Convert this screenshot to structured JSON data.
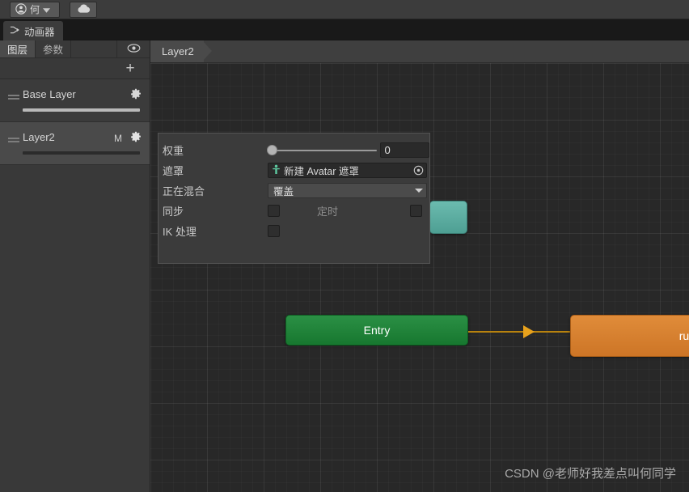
{
  "titlebar": {
    "account_icon": "account-avatar-icon",
    "account_name": "何",
    "dropdown_icon": "chevron-down-icon",
    "cloud_icon": "cloud-icon"
  },
  "window_tab": {
    "icon": "animator-node-icon",
    "label": "动画器"
  },
  "left_panel": {
    "tabs": [
      {
        "label": "图层",
        "active": true
      },
      {
        "label": "参数",
        "active": false
      }
    ],
    "visibility_icon": "eye-icon",
    "add_label": "+",
    "layers": [
      {
        "name": "Base Layer",
        "mask_flag": "",
        "weight_percent": 100,
        "selected": false,
        "gear_icon": "gear-icon",
        "handle_icon": "drag-handle-icon"
      },
      {
        "name": "Layer2",
        "mask_flag": "M",
        "weight_percent": 0,
        "selected": true,
        "gear_icon": "gear-icon",
        "handle_icon": "drag-handle-icon"
      }
    ]
  },
  "breadcrumb": {
    "current": "Layer2"
  },
  "inspector": {
    "weight": {
      "label": "权重",
      "value": "0",
      "slider_percent": 0
    },
    "mask": {
      "label": "遮罩",
      "value": "新建 Avatar 遮罩",
      "avatar_icon": "avatar-mask-icon",
      "picker_icon": "object-picker-icon"
    },
    "blending": {
      "label": "正在混合",
      "value": "覆盖",
      "caret_icon": "chevron-down-icon"
    },
    "sync": {
      "label": "同步",
      "checked": false,
      "timing_label": "定时",
      "timing_checked": false
    },
    "ik": {
      "label": "IK 处理",
      "checked": false
    }
  },
  "graph": {
    "nodes": [
      {
        "name": "Entry",
        "label": "Entry",
        "color": "#1e8238"
      },
      {
        "name": "any-state-node",
        "label": "",
        "color": "#5aa99d"
      },
      {
        "name": "run-state",
        "label": "run",
        "color": "#d8812f"
      }
    ],
    "transition_color": "#b8820e"
  },
  "watermark": {
    "text": "CSDN @老师好我差点叫何同学"
  }
}
